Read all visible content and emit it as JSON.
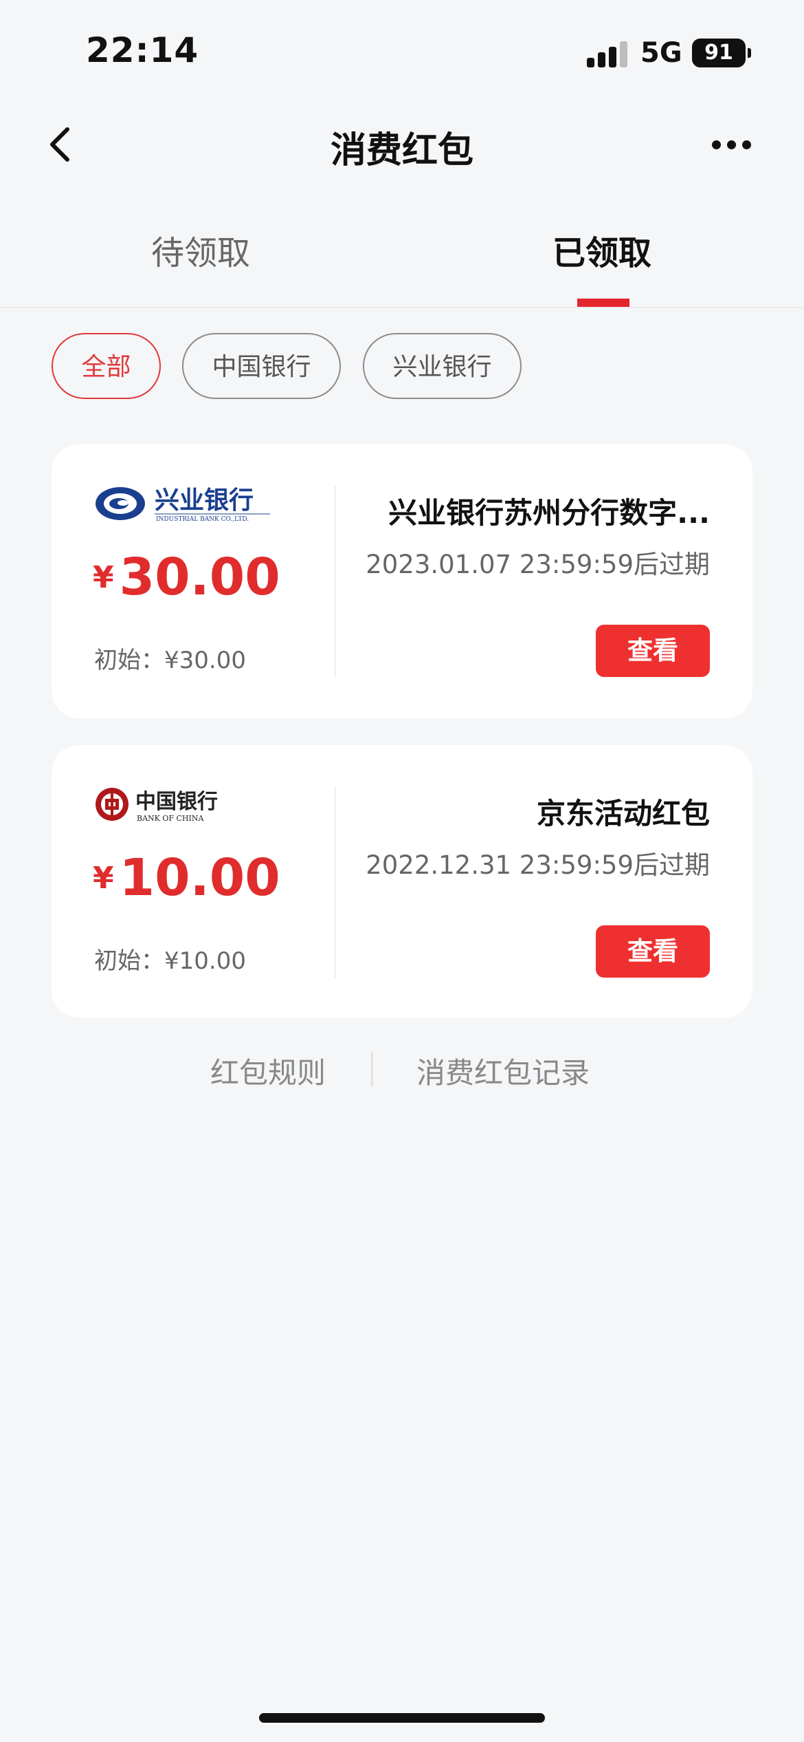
{
  "status_bar": {
    "time": "22:14",
    "network": "5G",
    "battery": "91"
  },
  "nav": {
    "title": "消费红包"
  },
  "tabs": [
    {
      "label": "待领取"
    },
    {
      "label": "已领取"
    }
  ],
  "filters": [
    {
      "label": "全部"
    },
    {
      "label": "中国银行"
    },
    {
      "label": "兴业银行"
    }
  ],
  "cards": [
    {
      "bank_cn": "兴业银行",
      "bank_en": "INDUSTRIAL BANK CO.,LTD.",
      "currency": "¥",
      "amount": "30.00",
      "initial": "初始：¥30.00",
      "title": "兴业银行苏州分行数字...",
      "expiry": "2023.01.07 23:59:59后过期",
      "button": "查看"
    },
    {
      "bank_cn": "中国银行",
      "bank_en": "BANK OF CHINA",
      "currency": "¥",
      "amount": "10.00",
      "initial": "初始：¥10.00",
      "title": "京东活动红包",
      "expiry": "2022.12.31 23:59:59后过期",
      "button": "查看"
    }
  ],
  "footer": {
    "rules": "红包规则",
    "records": "消费红包记录"
  },
  "colors": {
    "accent": "#e5252e",
    "button": "#ef3030",
    "background": "#f5f6f8",
    "cib_blue": "#1a3f8f",
    "boc_red": "#b0181c"
  }
}
